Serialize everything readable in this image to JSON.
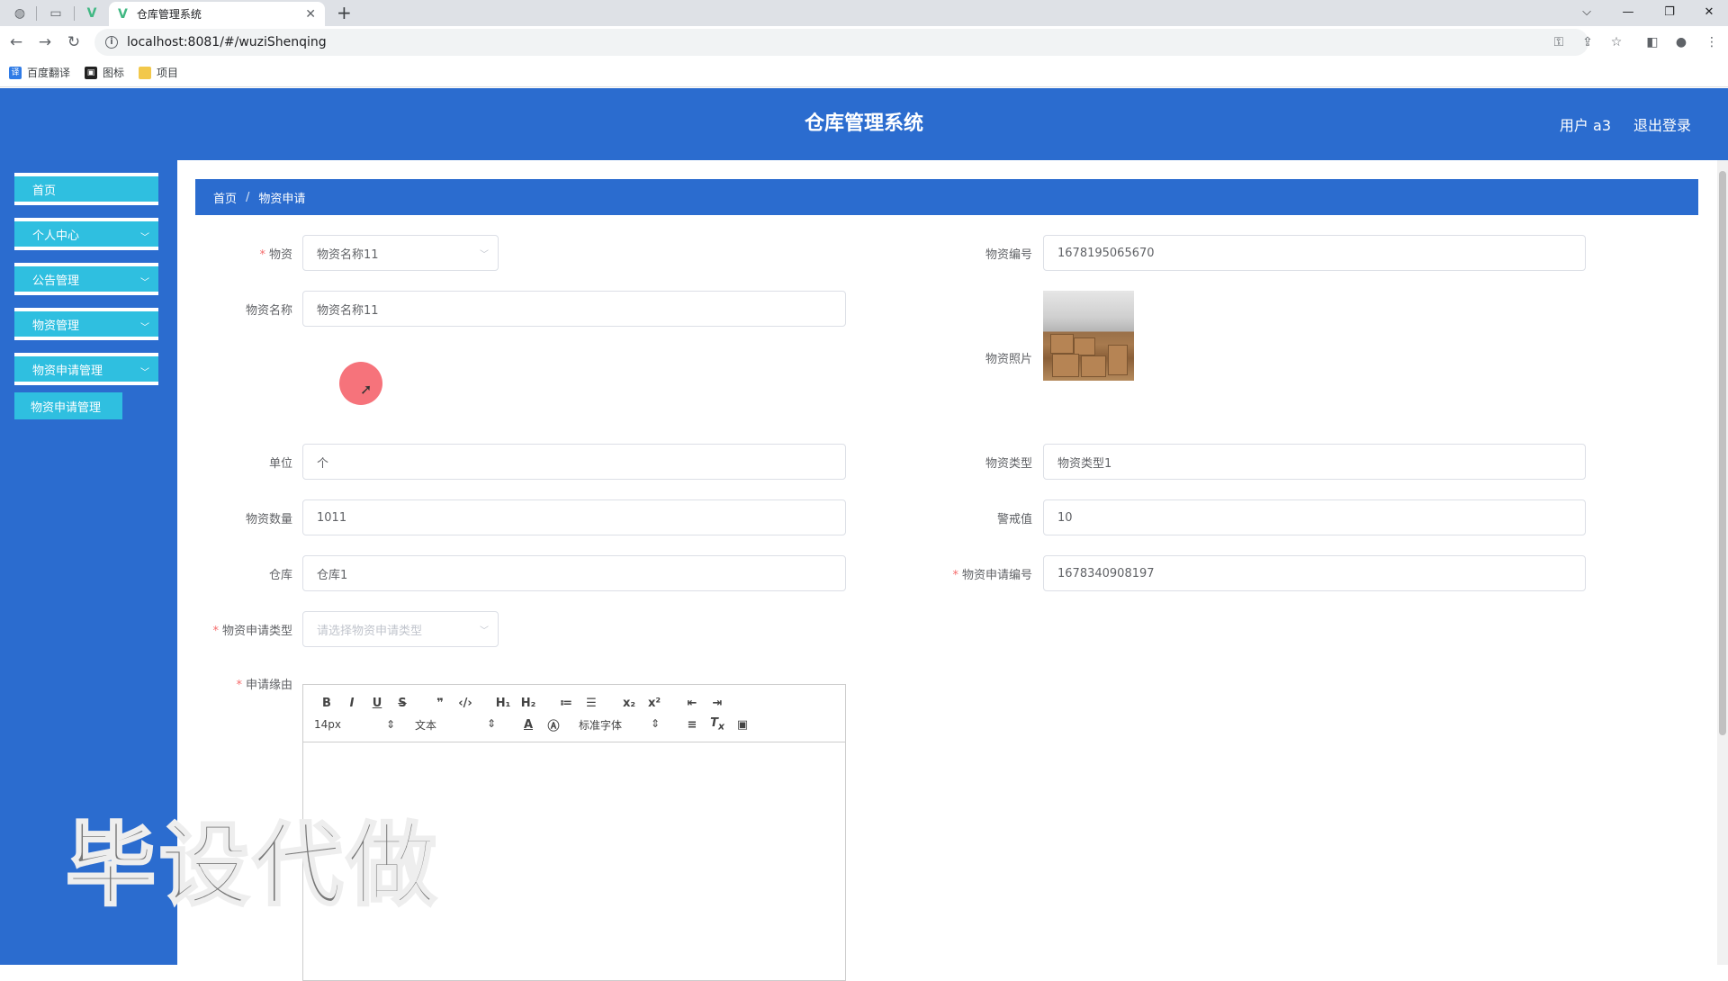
{
  "browser": {
    "tab_title": "仓库管理系统",
    "url": "localhost:8081/#/wuziShenqing",
    "bookmarks": [
      "百度翻译",
      "图标",
      "项目"
    ]
  },
  "header": {
    "title": "仓库管理系统",
    "user": "用户 a3",
    "logout": "退出登录"
  },
  "sidebar": {
    "items": [
      {
        "label": "首页"
      },
      {
        "label": "个人中心"
      },
      {
        "label": "公告管理"
      },
      {
        "label": "物资管理"
      },
      {
        "label": "物资申请管理"
      }
    ],
    "sub_item": "物资申请管理"
  },
  "breadcrumb": {
    "home": "首页",
    "sep": "/",
    "current": "物资申请"
  },
  "form": {
    "wuzi_label": "物资",
    "wuzi_value": "物资名称11",
    "bianhao_label": "物资编号",
    "bianhao_value": "1678195065670",
    "name_label": "物资名称",
    "name_value": "物资名称11",
    "photo_label": "物资照片",
    "unit_label": "单位",
    "unit_value": "个",
    "type_label": "物资类型",
    "type_value": "物资类型1",
    "qty_label": "物资数量",
    "qty_value": "1011",
    "warn_label": "警戒值",
    "warn_value": "10",
    "warehouse_label": "仓库",
    "warehouse_value": "仓库1",
    "apply_no_label": "物资申请编号",
    "apply_no_value": "1678340908197",
    "apply_type_label": "物资申请类型",
    "apply_type_placeholder": "请选择物资申请类型",
    "reason_label": "申请缘由"
  },
  "editor": {
    "size": "14px",
    "block": "文本",
    "font": "标准字体"
  },
  "watermark": "毕设代做"
}
